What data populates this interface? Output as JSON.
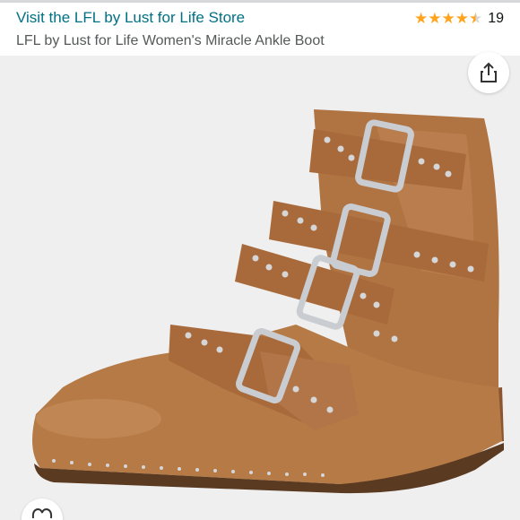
{
  "header": {
    "store_link": "Visit the LFL by Lust for Life Store",
    "rating_stars": 4.5,
    "review_count": "19",
    "product_title": "LFL by Lust for Life Women's Miracle Ankle Boot"
  },
  "colors": {
    "link": "#007185",
    "star": "#ffa41c",
    "boot_leather": "#b57a45",
    "hardware": "#c9ccd0"
  },
  "icons": {
    "share": "share-icon",
    "favorite": "heart-icon"
  }
}
